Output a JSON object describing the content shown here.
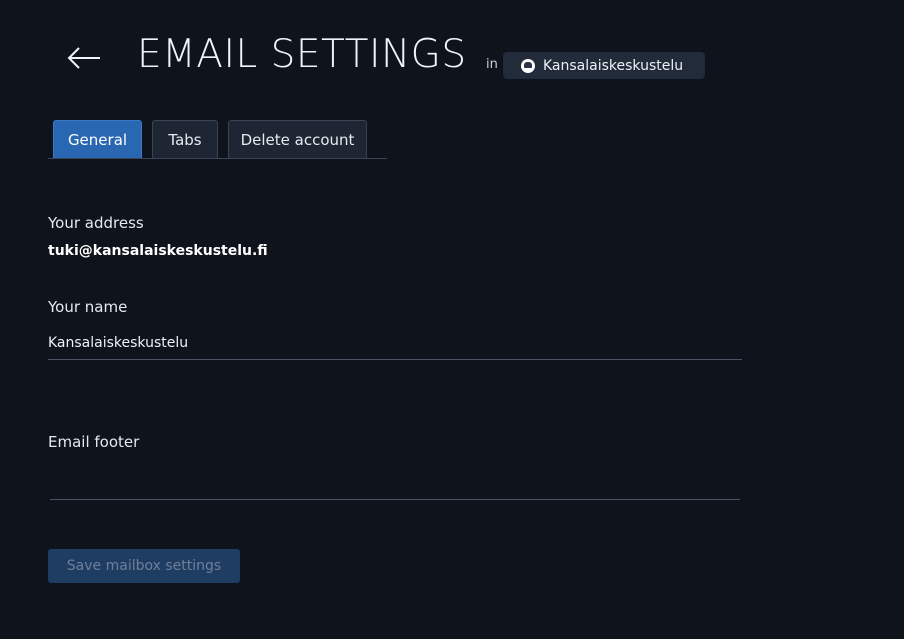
{
  "header": {
    "title": "EMAIL SETTINGS",
    "in_label": "in",
    "organization": "Kansalaiskeskustelu"
  },
  "tabs": [
    {
      "label": "General",
      "active": true
    },
    {
      "label": "Tabs",
      "active": false
    },
    {
      "label": "Delete account",
      "active": false
    }
  ],
  "form": {
    "address_label": "Your address",
    "address_value": "tuki@kansalaiskeskustelu.fi",
    "name_label": "Your name",
    "name_value": "Kansalaiskeskustelu",
    "footer_label": "Email footer",
    "footer_value": ""
  },
  "actions": {
    "save_label": "Save mailbox settings"
  },
  "colors": {
    "background": "#0f131b",
    "active_tab": "#2a67b3",
    "save_button_disabled": "#1f3d63"
  },
  "icons": {
    "back": "arrow-left-icon",
    "org_avatar": "avatar-icon"
  }
}
